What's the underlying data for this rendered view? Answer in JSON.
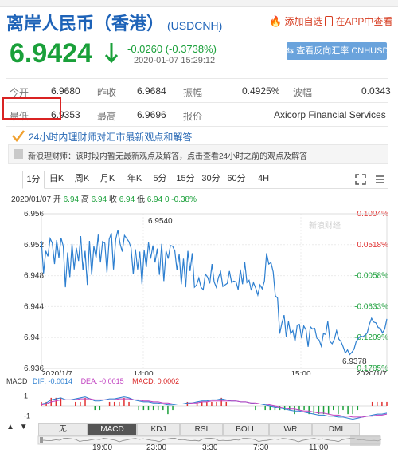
{
  "header": {
    "title": "离岸人民币（香港）",
    "code": "(USDCNH)",
    "add_watch": "添加自选",
    "app_view": "在APP中查看",
    "price": "6.9424",
    "change": "-0.0260 (-0.3738%)",
    "timestamp": "2020-01-07 15:29:12",
    "reverse_button": "查看反向汇率 CNHUSD"
  },
  "colors": {
    "down": "#1aa03a",
    "up": "#e23232",
    "accent": "#1e63b8",
    "highlight": "#d92323"
  },
  "stats": [
    [
      {
        "label": "今开",
        "value": "6.9680"
      },
      {
        "label": "昨收",
        "value": "6.9684"
      },
      {
        "label": "振幅",
        "value": "0.4925%"
      },
      {
        "label": "波幅",
        "value": "0.0343"
      }
    ],
    [
      {
        "label": "最低",
        "value": "6.9353"
      },
      {
        "label": "最高",
        "value": "6.9696"
      },
      {
        "label": "报价",
        "value": "Axicorp Financial Services"
      }
    ]
  ],
  "notice": {
    "title": "24小时内理财师对汇市最新观点和解答",
    "sub": "新浪理财师：该时段内暂无最新观点及解答，点击查看24小时之前的观点及解答"
  },
  "period_tabs": [
    "1分",
    "日K",
    "周K",
    "月K",
    "年K",
    "5分",
    "15分",
    "30分",
    "60分",
    "4H"
  ],
  "ohlc": {
    "date": "2020/01/07",
    "open_label": "开",
    "open": "6.94",
    "high_label": "高",
    "high": "6.94",
    "close_label": "收",
    "close": "6.94",
    "low_label": "低",
    "low": "6.94",
    "change": "0 -0.38%"
  },
  "watermark": "新浪财经",
  "chart_data": {
    "type": "line",
    "y_left_ticks": [
      "6.956",
      "6.952",
      "6.948",
      "6.944",
      "6.94",
      "6.936"
    ],
    "y_right_ticks": [
      "0.1094%",
      "0.0518%",
      "-0.0058%",
      "-0.0633%",
      "-0.1209%",
      "-0.1785%"
    ],
    "x_ticks": [
      "2020/1/7",
      "14:00",
      "15:00",
      "2020/1/7"
    ],
    "ylim": [
      6.936,
      6.956
    ],
    "max_label": "6.9540",
    "min_label": "6.9378",
    "series": [
      {
        "values": [
          6.9525,
          6.9483,
          6.9512,
          6.9505,
          6.9528,
          6.9522,
          6.9495,
          6.9526,
          6.9503,
          6.9529,
          6.9518,
          6.9465,
          6.951,
          6.9478,
          6.9521,
          6.9488,
          6.9516,
          6.9499,
          6.9531,
          6.9487,
          6.9512,
          6.9468,
          6.9525,
          6.9481,
          6.9518,
          6.9503,
          6.9533,
          6.9497,
          6.9524,
          6.9522,
          6.9484,
          6.9527,
          6.9535,
          6.9488,
          6.9527,
          6.9539,
          6.9521,
          6.9511,
          6.9532,
          6.9528,
          6.9524,
          6.9516,
          6.9482,
          6.9514,
          6.9488,
          6.9511,
          6.9469,
          6.9513,
          6.9491,
          6.9523,
          6.9502,
          6.9519,
          6.9497,
          6.9515,
          6.9481,
          6.9521,
          6.9473,
          6.9512,
          6.9502,
          6.9519,
          6.9518,
          6.9512,
          6.9487,
          6.9508,
          6.9469,
          6.9502,
          6.9465,
          6.9512,
          6.9486,
          6.9509,
          6.9465,
          6.9468,
          6.9477,
          6.9465,
          6.9462,
          6.9482,
          6.9478,
          6.947,
          6.9495,
          6.9472,
          6.9465,
          6.9478,
          6.9485,
          6.9466,
          6.9468,
          6.947,
          6.9486,
          6.9471,
          6.9473,
          6.9472,
          6.9462,
          6.9488,
          6.9469,
          6.9497,
          6.9471,
          6.9474,
          6.9461,
          6.9471,
          6.9464,
          6.9455,
          6.9468,
          6.9463,
          6.9473,
          6.9509,
          6.9495,
          6.9497,
          6.9485,
          6.9454,
          6.9451,
          6.9405,
          6.9419,
          6.9429,
          6.9401,
          6.9421,
          6.9405,
          6.9409,
          6.9395,
          6.9416,
          6.9417,
          6.9399,
          6.9415,
          6.941,
          6.9388,
          6.9414,
          6.9411,
          6.9412,
          6.9399,
          6.9397,
          6.9389,
          6.9405,
          6.9404,
          6.9421,
          6.9395,
          6.9392,
          6.9398,
          6.9409,
          6.9398,
          6.9395,
          6.9388,
          6.938,
          6.9384,
          6.9378,
          6.9381,
          6.9385,
          6.9395,
          6.9399,
          6.9402,
          6.9401,
          6.9403,
          6.9406,
          6.9417,
          6.9425,
          6.942,
          6.9419,
          6.9413,
          6.9412,
          6.9406,
          6.9411,
          6.9424
        ]
      }
    ]
  },
  "macd": {
    "label": "MACD",
    "dif": "DIF: -0.0014",
    "dea": "DEA: -0.0015",
    "macd": "MACD: 0.0002",
    "y_ticks": [
      "1",
      "-1"
    ],
    "series": [
      {
        "name": "DIF",
        "values": [
          0.2,
          0.3,
          0.6,
          0.7,
          0.8,
          0.6,
          0.6,
          0.7,
          0.8,
          0.9,
          0.7,
          0.5,
          0.5,
          0.6,
          0.7,
          0.7,
          0.8,
          0.9,
          0.8,
          0.6,
          0.5,
          0.4,
          0.4,
          0.3,
          0.3,
          0.2,
          0.1,
          0.1,
          0.2,
          0.2,
          0.3,
          0.3,
          0.4,
          0.5,
          0.5,
          0.6,
          0.6,
          0.7,
          0.6,
          0.5,
          0.5,
          0.4,
          0.4,
          0.3,
          0.2,
          0.2,
          0.1,
          0.0,
          -0.1,
          -0.2,
          -0.3,
          -0.4,
          -0.5,
          -0.5,
          -0.6,
          -0.7,
          -0.8,
          -0.9,
          -0.9,
          -1.0,
          -1.0,
          -1.1,
          -1.1,
          -1.2,
          -1.3,
          -1.2,
          -1.1,
          -1.0,
          -0.9,
          -0.8,
          -0.8,
          -0.7
        ]
      },
      {
        "name": "DEA",
        "values": [
          0.1,
          0.2,
          0.4,
          0.5,
          0.6,
          0.6,
          0.6,
          0.6,
          0.7,
          0.7,
          0.7,
          0.6,
          0.6,
          0.6,
          0.6,
          0.6,
          0.7,
          0.7,
          0.7,
          0.6,
          0.6,
          0.5,
          0.5,
          0.4,
          0.4,
          0.3,
          0.3,
          0.2,
          0.2,
          0.2,
          0.2,
          0.3,
          0.3,
          0.4,
          0.4,
          0.5,
          0.5,
          0.5,
          0.5,
          0.5,
          0.5,
          0.4,
          0.4,
          0.3,
          0.3,
          0.2,
          0.2,
          0.1,
          0.0,
          -0.1,
          -0.2,
          -0.3,
          -0.3,
          -0.4,
          -0.5,
          -0.5,
          -0.6,
          -0.7,
          -0.7,
          -0.8,
          -0.9,
          -0.9,
          -1.0,
          -1.0,
          -1.1,
          -1.1,
          -1.1,
          -1.0,
          -1.0,
          -0.9,
          -0.9,
          -0.8
        ]
      }
    ]
  },
  "indicator_tabs": [
    "无",
    "MACD",
    "KDJ",
    "RSI",
    "BOLL",
    "WR",
    "DMI"
  ],
  "timeline_ticks": [
    "19:00",
    "23:00",
    "3:30",
    "7:30",
    "11:00"
  ]
}
